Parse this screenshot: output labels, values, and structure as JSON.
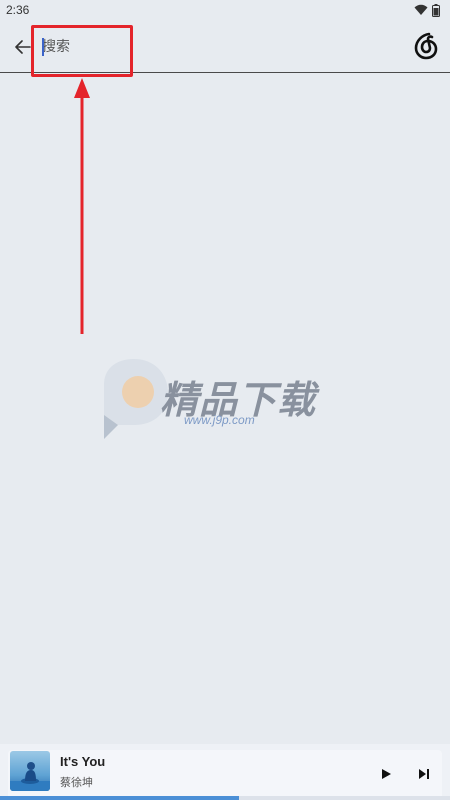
{
  "status_bar": {
    "time": "2:36",
    "icons": [
      "wifi-icon",
      "battery-icon"
    ]
  },
  "search": {
    "placeholder": "搜索",
    "value": ""
  },
  "header_icons": {
    "back": "arrow-left-icon",
    "app_logo": "netease-music-logo-icon"
  },
  "watermark": {
    "text": "精品下载",
    "url": "www.j9p.com"
  },
  "player": {
    "title": "It's You",
    "artist": "蔡徐坤",
    "progress": 0.53
  },
  "colors": {
    "background": "#e7ebf0",
    "highlight": "#e4242b",
    "progress": "#4b8fd6"
  }
}
